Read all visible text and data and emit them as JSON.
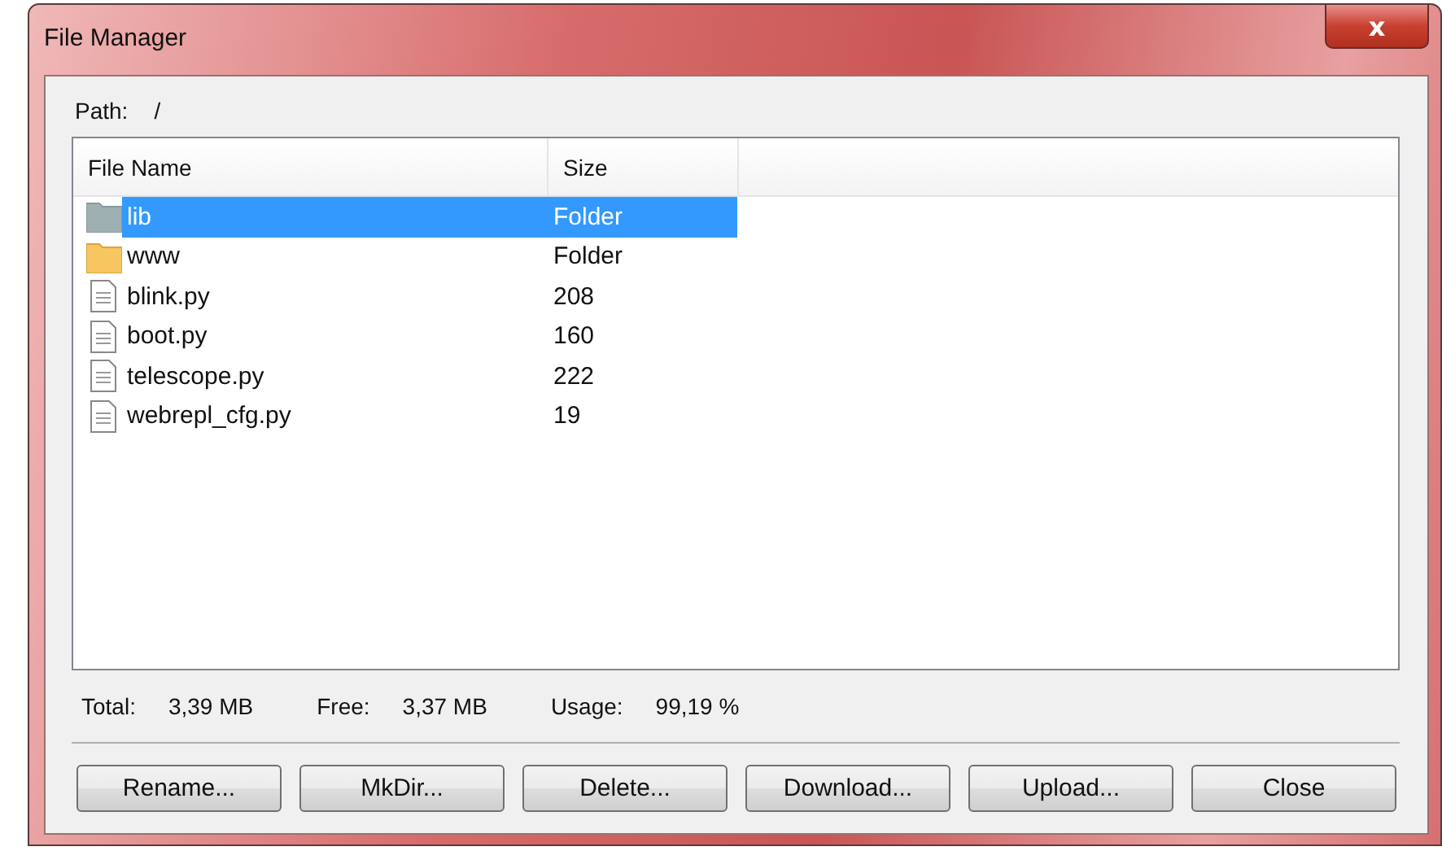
{
  "window": {
    "title": "File Manager",
    "close_label": "x"
  },
  "path": {
    "label": "Path:",
    "value": "/"
  },
  "table": {
    "columns": [
      "File Name",
      "Size"
    ],
    "rows": [
      {
        "name": "lib",
        "size": "Folder",
        "kind": "folder",
        "selected": true
      },
      {
        "name": "www",
        "size": "Folder",
        "kind": "folder",
        "selected": false
      },
      {
        "name": "blink.py",
        "size": "208",
        "kind": "file",
        "selected": false
      },
      {
        "name": "boot.py",
        "size": "160",
        "kind": "file",
        "selected": false
      },
      {
        "name": "telescope.py",
        "size": "222",
        "kind": "file",
        "selected": false
      },
      {
        "name": "webrepl_cfg.py",
        "size": "19",
        "kind": "file",
        "selected": false
      }
    ]
  },
  "stats": [
    {
      "label": "Total:",
      "value": "3,39 MB"
    },
    {
      "label": "Free:",
      "value": "3,37 MB"
    },
    {
      "label": "Usage:",
      "value": "99,19 %"
    }
  ],
  "buttons": [
    "Rename...",
    "MkDir...",
    "Delete...",
    "Download...",
    "Upload...",
    "Close"
  ]
}
